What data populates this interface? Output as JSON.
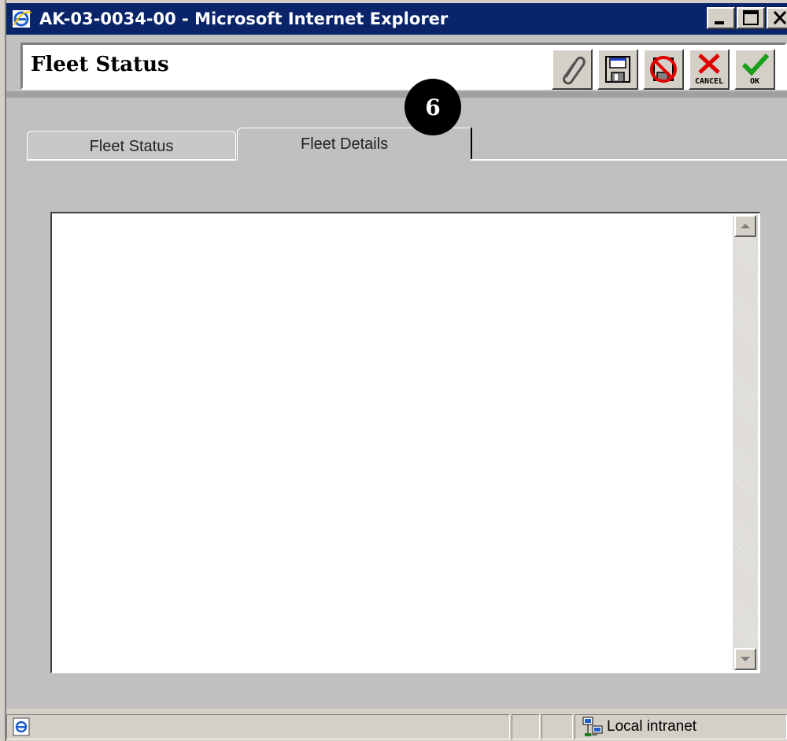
{
  "window": {
    "title": "AK-03-0034-00 - Microsoft Internet Explorer",
    "controls": [
      "minimize-icon",
      "maximize-icon",
      "close-icon"
    ]
  },
  "header": {
    "title": "Fleet Status",
    "toolbar": [
      {
        "name": "attach-button",
        "icon": "paperclip-icon"
      },
      {
        "name": "save-button",
        "icon": "floppy-disk-icon"
      },
      {
        "name": "no-save-button",
        "icon": "no-save-icon"
      },
      {
        "name": "cancel-button",
        "icon": "cancel-icon",
        "label": "CANCEL"
      },
      {
        "name": "ok-button",
        "icon": "checkmark-icon",
        "label": "OK"
      }
    ]
  },
  "tabs": [
    {
      "label": "Fleet Status",
      "active": false
    },
    {
      "label": "Fleet Details",
      "active": true
    }
  ],
  "callout": {
    "number": "6"
  },
  "statusbar": {
    "zone": "Local intranet"
  },
  "colors": {
    "titlebar": "#0a246a",
    "chrome": "#d4d0c8",
    "cancel_red": "#e00000",
    "ok_green": "#1aa01a"
  }
}
